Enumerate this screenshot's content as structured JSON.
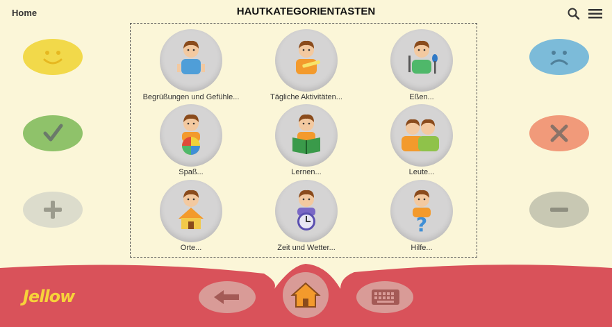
{
  "header": {
    "home_label": "Home",
    "title": "HAUTKATEGORIENTASTEN",
    "search_icon": "search-icon",
    "menu_icon": "menu-icon"
  },
  "categories": [
    {
      "label": "Begrüßungen und Gefühle..."
    },
    {
      "label": "Tägliche Aktivitäten..."
    },
    {
      "label": "Eßen..."
    },
    {
      "label": "Spaß..."
    },
    {
      "label": "Lernen..."
    },
    {
      "label": "Leute..."
    },
    {
      "label": "Orte..."
    },
    {
      "label": "Zeit und Wetter..."
    },
    {
      "label": "Hilfe..."
    }
  ],
  "side_buttons": {
    "left": [
      "smiley-icon",
      "check-icon",
      "plus-icon"
    ],
    "right": [
      "sad-icon",
      "cross-icon",
      "minus-icon"
    ]
  },
  "footer": {
    "logo": "Jellow",
    "buttons": [
      "back-arrow-icon",
      "home-icon",
      "keyboard-icon"
    ]
  },
  "colors": {
    "background": "#fbf6d8",
    "footer": "#d9525a",
    "like": "#f2d94a",
    "yes": "#8fc26a",
    "more": "#c9c7bb",
    "dislike": "#7cbbd9",
    "no": "#f19a7a",
    "less": "#bfbfa6"
  }
}
